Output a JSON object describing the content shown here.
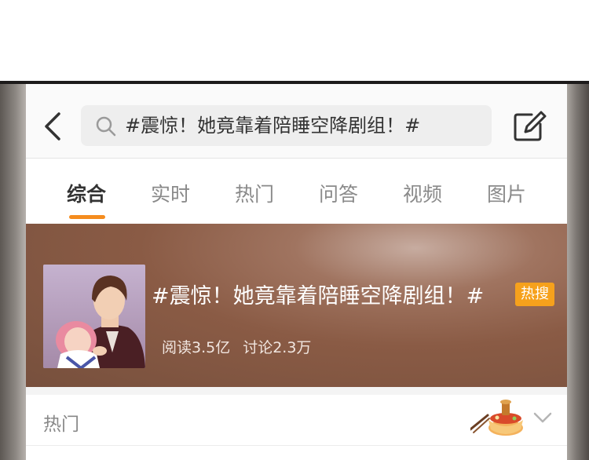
{
  "search": {
    "query": "#震惊！她竟靠着陪睡空降剧组！#"
  },
  "tabs": [
    {
      "label": "综合"
    },
    {
      "label": "实时"
    },
    {
      "label": "热门"
    },
    {
      "label": "问答"
    },
    {
      "label": "视频"
    },
    {
      "label": "图片"
    }
  ],
  "topic": {
    "title": "#震惊！她竟靠着陪睡空降剧组！#",
    "badge": "热搜",
    "reads": "阅读3.5亿",
    "discussions": "讨论2.3万"
  },
  "section": {
    "label": "热门"
  },
  "icons": {
    "back": "chevron-left-icon",
    "search": "search-icon",
    "edit": "edit-icon",
    "hotpot": "hotpot-icon",
    "expand": "chevron-down-icon"
  },
  "colors": {
    "accent": "#f58c1e",
    "badge": "#f6a11c",
    "header_bg": "#8a5b45"
  }
}
